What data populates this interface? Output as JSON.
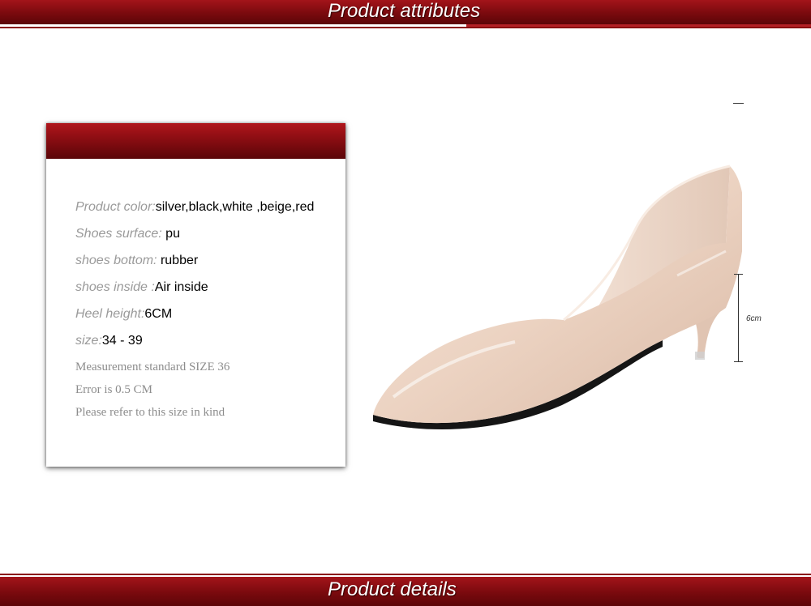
{
  "header": {
    "title": "Product attributes"
  },
  "footer": {
    "title": "Product details"
  },
  "attributes": [
    {
      "label": "Product color:",
      "value": "silver,black,white ,beige,red"
    },
    {
      "label": "Shoes  surface: ",
      "value": "pu"
    },
    {
      "label": "shoes  bottom:  ",
      "value": "rubber"
    },
    {
      "label": "shoes  inside :",
      "value": "Air inside"
    },
    {
      "label": "Heel height:",
      "value": "6CM"
    },
    {
      "label": "size:",
      "value": "34 - 39"
    }
  ],
  "notes": [
    "Measurement standard SIZE 36",
    "Error is 0.5 CM",
    "Please refer to this size in kind"
  ],
  "product_image": {
    "dimension_label": "6cm",
    "shoe_color": "#efd9c9"
  },
  "colors": {
    "banner": "#8a0d12",
    "label_gray": "#9a9a9a"
  }
}
